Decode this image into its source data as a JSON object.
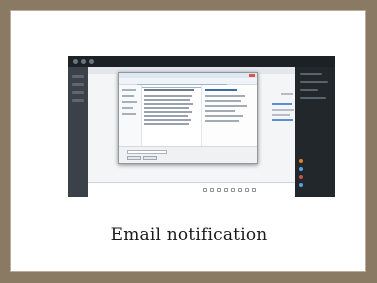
{
  "card": {
    "caption": "Email notification"
  },
  "screenshot": {
    "description_icon": "file-attach-dialog-icon",
    "colors": {
      "background": "#8a7a64",
      "card": "#ffffff",
      "desktop": "#2a3036",
      "dialog_header": "#dfe7f1",
      "link": "#5a8fd1"
    }
  }
}
